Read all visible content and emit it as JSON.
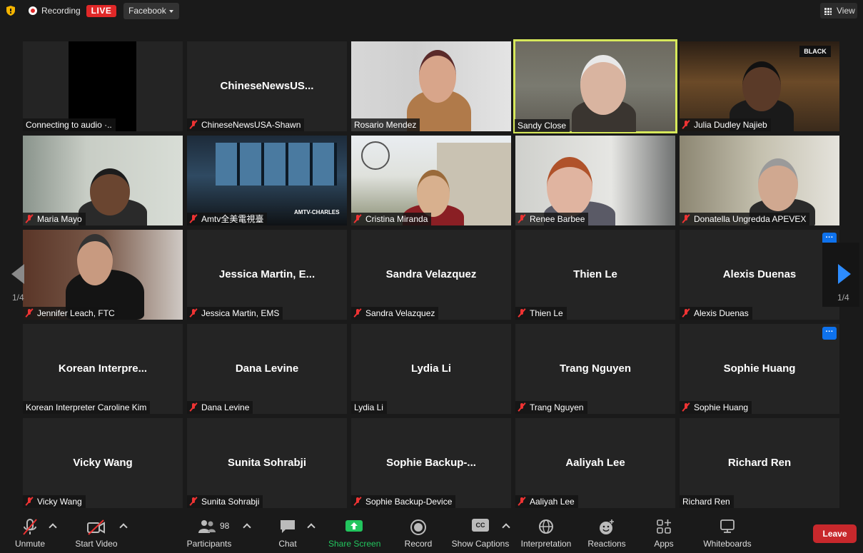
{
  "topbar": {
    "recording_label": "Recording",
    "live_label": "LIVE",
    "stream_target": "Facebook",
    "view_label": "View"
  },
  "tiles": [
    {
      "name": "Connecting to audio ·..",
      "center": "",
      "muted": false
    },
    {
      "name": "ChineseNewsUSA-Shawn",
      "center": "ChineseNewsUS...",
      "muted": true
    },
    {
      "name": "Rosario Mendez",
      "center": "",
      "muted": false
    },
    {
      "name": "Sandy Close",
      "center": "",
      "muted": false,
      "active": true
    },
    {
      "name": "Julia Dudley Najieb",
      "center": "",
      "muted": true
    },
    {
      "name": "Maria Mayo",
      "center": "",
      "muted": true
    },
    {
      "name": "Amtv全美電視臺",
      "center": "",
      "muted": true,
      "overlay": "AMTV-CHARLES"
    },
    {
      "name": "Cristina Miranda",
      "center": "",
      "muted": true
    },
    {
      "name": "Renee Barbee",
      "center": "",
      "muted": true
    },
    {
      "name": "Donatella Ungredda APEVEX",
      "center": "",
      "muted": true
    },
    {
      "name": "Jennifer Leach, FTC",
      "center": "",
      "muted": true
    },
    {
      "name": "Jessica Martin, EMS",
      "center": "Jessica Martin, E...",
      "muted": true
    },
    {
      "name": "Sandra Velazquez",
      "center": "Sandra Velazquez",
      "muted": true
    },
    {
      "name": "Thien Le",
      "center": "Thien Le",
      "muted": true
    },
    {
      "name": "Alexis Duenas",
      "center": "Alexis Duenas",
      "muted": true
    },
    {
      "name": "Korean Interpreter Caroline Kim",
      "center": "Korean Interpre...",
      "muted": false
    },
    {
      "name": "Dana Levine",
      "center": "Dana Levine",
      "muted": true
    },
    {
      "name": "Lydia Li",
      "center": "Lydia Li",
      "muted": false
    },
    {
      "name": "Trang Nguyen",
      "center": "Trang Nguyen",
      "muted": true
    },
    {
      "name": "Sophie Huang",
      "center": "Sophie Huang",
      "muted": true
    },
    {
      "name": "Vicky Wang",
      "center": "Vicky Wang",
      "muted": true
    },
    {
      "name": "Sunita Sohrabji",
      "center": "Sunita Sohrabji",
      "muted": true
    },
    {
      "name": "Sophie Backup-Device",
      "center": "Sophie Backup-...",
      "muted": true
    },
    {
      "name": "Aaliyah Lee",
      "center": "Aaliyah Lee",
      "muted": true
    },
    {
      "name": "Richard Ren",
      "center": "Richard Ren",
      "muted": false
    }
  ],
  "more_button_label": "···",
  "julia_overlay": "BLACK",
  "pagination": {
    "left": "1/4",
    "right": "1/4"
  },
  "toolbar": {
    "unmute": "Unmute",
    "start_video": "Start Video",
    "participants": "Participants",
    "participants_count": "98",
    "chat": "Chat",
    "share_screen": "Share Screen",
    "record": "Record",
    "show_captions": "Show Captions",
    "cc": "CC",
    "interpretation": "Interpretation",
    "reactions": "Reactions",
    "apps": "Apps",
    "whiteboards": "Whiteboards",
    "leave": "Leave"
  },
  "colors": {
    "accent": "#0e72ed",
    "live": "#e02828",
    "active_speaker": "#d6e85a",
    "share": "#22c55e",
    "leave": "#c8282c"
  }
}
